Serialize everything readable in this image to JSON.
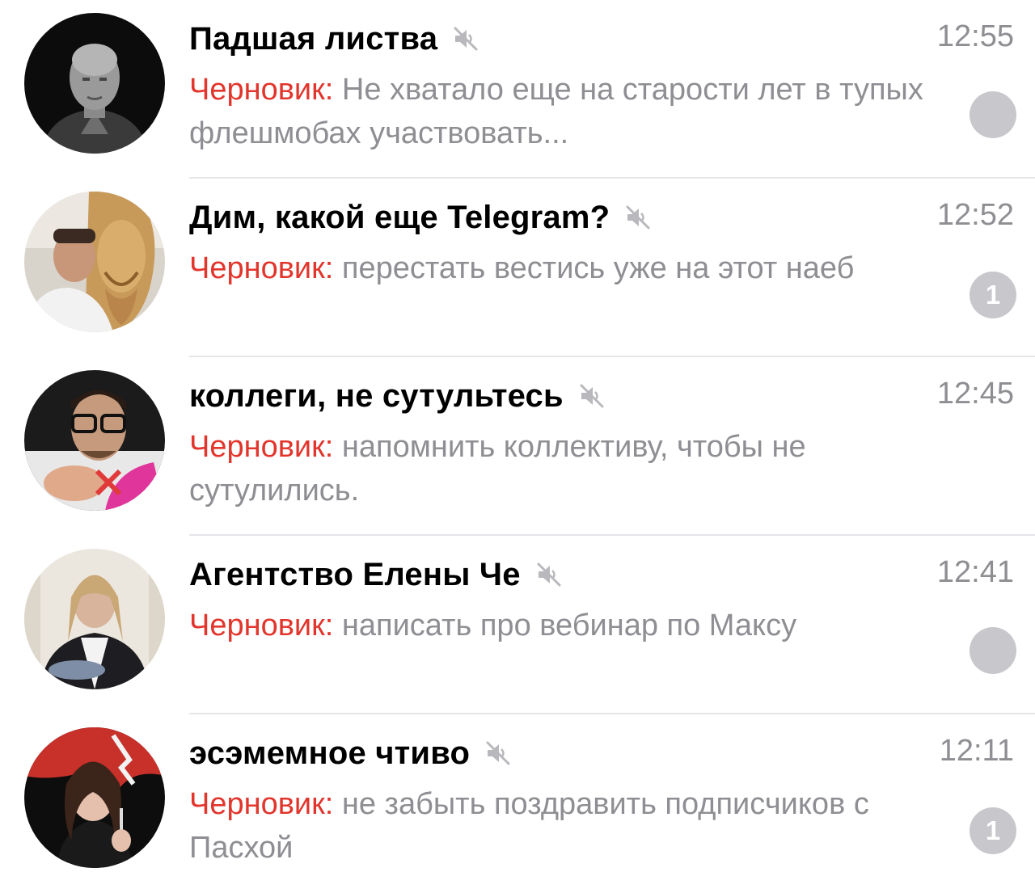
{
  "chats": [
    {
      "title": "Падшая листва",
      "time": "12:55",
      "draft_label": "Черновик:",
      "preview": "Не хватало еще на старости лет в тупых флешмобах участвовать...",
      "badge": "",
      "muted": true
    },
    {
      "title": "Дим, какой еще Telegram?",
      "time": "12:52",
      "draft_label": "Черновик:",
      "preview": "перестать вестись уже на этот наеб",
      "badge": "1",
      "muted": true
    },
    {
      "title": "коллеги, не сутультесь",
      "time": "12:45",
      "draft_label": "Черновик:",
      "preview": "напомнить коллективу, чтобы не сутулились.",
      "badge": "",
      "muted": true
    },
    {
      "title": "Агентство Елены Че",
      "time": "12:41",
      "draft_label": "Черновик:",
      "preview": "написать про вебинар по Максу",
      "badge": "",
      "muted": true
    },
    {
      "title": "эсэмемное чтиво",
      "time": "12:11",
      "draft_label": "Черновик:",
      "preview": "не забыть поздравить подписчиков с Пасхой",
      "badge": "1",
      "muted": true
    }
  ],
  "colors": {
    "draft": "#e2352c",
    "secondary_text": "#8e8e93",
    "badge": "#c7c7cc",
    "separator": "#e5e5ea"
  }
}
